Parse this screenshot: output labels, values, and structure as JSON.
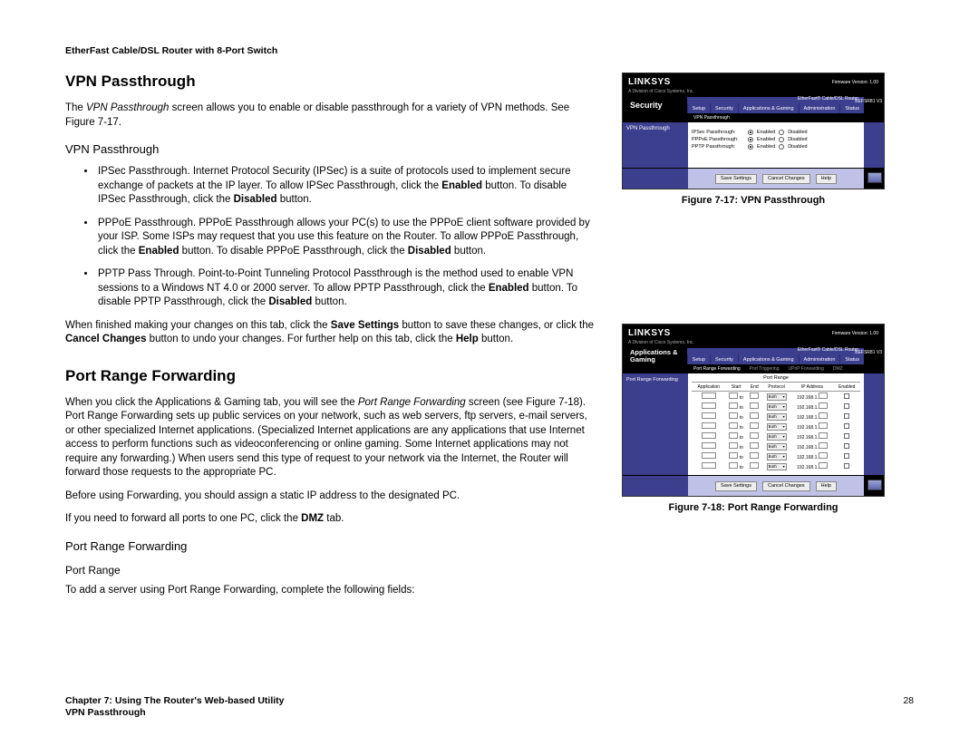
{
  "header": "EtherFast Cable/DSL Router with 8-Port Switch",
  "section1": {
    "title": "VPN Passthrough",
    "intro_a": "The ",
    "intro_em": "VPN Passthrough",
    "intro_b": " screen allows you to enable or disable passthrough for a variety of VPN methods. See Figure 7-17.",
    "subhead": "VPN Passthrough",
    "bullets": {
      "b1": {
        "a": "IPSec Passthrough. Internet Protocol Security (IPSec) is a suite of protocols used to implement secure exchange of packets at the IP layer. To allow IPSec Passthrough, click the ",
        "s1": "Enabled",
        "b": " button. To disable IPSec Passthrough, click the ",
        "s2": "Disabled",
        "c": " button."
      },
      "b2": {
        "a": "PPPoE Passthrough. PPPoE Passthrough allows your PC(s) to use the PPPoE client software provided by your ISP. Some ISPs may request that you use this feature on the Router. To allow PPPoE Passthrough, click the ",
        "s1": "Enabled",
        "b": " button. To disable PPPoE Passthrough, click the ",
        "s2": "Disabled",
        "c": " button."
      },
      "b3": {
        "a": "PPTP Pass Through. Point-to-Point Tunneling Protocol Passthrough is the method used to enable VPN sessions to a Windows NT 4.0 or 2000 server. To allow PPTP Passthrough, click the ",
        "s1": "Enabled",
        "b": " button. To disable PPTP Passthrough, click the ",
        "s2": "Disabled",
        "c": " button."
      }
    },
    "closing": {
      "a": "When finished making your changes on this tab, click the ",
      "s1": "Save Settings",
      "b": " button to save these changes, or click the ",
      "s2": "Cancel Changes",
      "c": " button to undo your changes. For further help on this tab, click the ",
      "s3": "Help",
      "d": " button."
    }
  },
  "section2": {
    "title": "Port Range Forwarding",
    "p1": {
      "a": "When you click the Applications & Gaming tab, you will see the ",
      "em": "Port Range Forwarding",
      "b": " screen (see Figure 7-18). Port Range Forwarding sets up public services on your network, such as web servers, ftp servers, e-mail servers, or other specialized Internet applications. (Specialized Internet applications are any applications that use Internet access to perform functions such as videoconferencing or online gaming. Some Internet applications may not require any forwarding.) When users send this type of request to your network via the Internet, the Router will forward those requests to the appropriate PC."
    },
    "p2": "Before using Forwarding, you should assign a static IP address to the designated PC.",
    "p3": {
      "a": "If you need to forward all ports to one PC, click the ",
      "s1": "DMZ",
      "b": " tab."
    },
    "subhead": "Port Range Forwarding",
    "subsub": "Port Range",
    "p4": "To add a server using Port Range Forwarding, complete the following fields:"
  },
  "fig1": {
    "caption": "Figure 7-17: VPN Passthrough",
    "brand": "LINKSYS",
    "brand_sub": "A Division of Cisco Systems, Inc.",
    "firmware": "Firmware Version: 1.00",
    "product": "EtherFast® Cable/DSL Router",
    "model": "BEFSR81 V3",
    "section_title": "Security",
    "tabs": [
      "Setup",
      "Security",
      "Applications & Gaming",
      "Administration",
      "Status"
    ],
    "subtabs": {
      "active": "VPN Passthrough"
    },
    "side_label": "VPN Passthrough",
    "rows": [
      {
        "label": "IPSec Passthrough",
        "enabled": "Enabled",
        "disabled": "Disabled"
      },
      {
        "label": "PPPoE Passthrough",
        "enabled": "Enabled",
        "disabled": "Disabled"
      },
      {
        "label": "PPTP Passthrough",
        "enabled": "Enabled",
        "disabled": "Disabled"
      }
    ],
    "buttons": {
      "save": "Save Settings",
      "cancel": "Cancel Changes",
      "help": "Help"
    }
  },
  "fig2": {
    "caption": "Figure 7-18: Port Range Forwarding",
    "brand": "LINKSYS",
    "brand_sub": "A Division of Cisco Systems, Inc.",
    "firmware": "Firmware Version: 1.00",
    "product": "EtherFast® Cable/DSL Router",
    "model": "BEFSR81 V3",
    "section_title": "Applications & Gaming",
    "tabs": [
      "Setup",
      "Security",
      "Applications & Gaming",
      "Administration",
      "Status"
    ],
    "subtabs": {
      "active": "Port Range Forwarding",
      "others": [
        "Port Triggering",
        "UPnP Forwarding",
        "DMZ"
      ]
    },
    "side_label": "Port Range Forwarding",
    "table": {
      "group": "Port Range",
      "headers": [
        "Application",
        "Start",
        "End",
        "Protocol",
        "IP Address",
        "Enabled"
      ],
      "proto": "Both",
      "ipprefix": "192.168.1.",
      "ipsuffix": "0",
      "rows": 8
    },
    "buttons": {
      "save": "Save Settings",
      "cancel": "Cancel Changes",
      "help": "Help"
    }
  },
  "footer": {
    "chapter": "Chapter 7: Using The Router's Web-based Utility",
    "section": "VPN Passthrough",
    "page": "28"
  }
}
